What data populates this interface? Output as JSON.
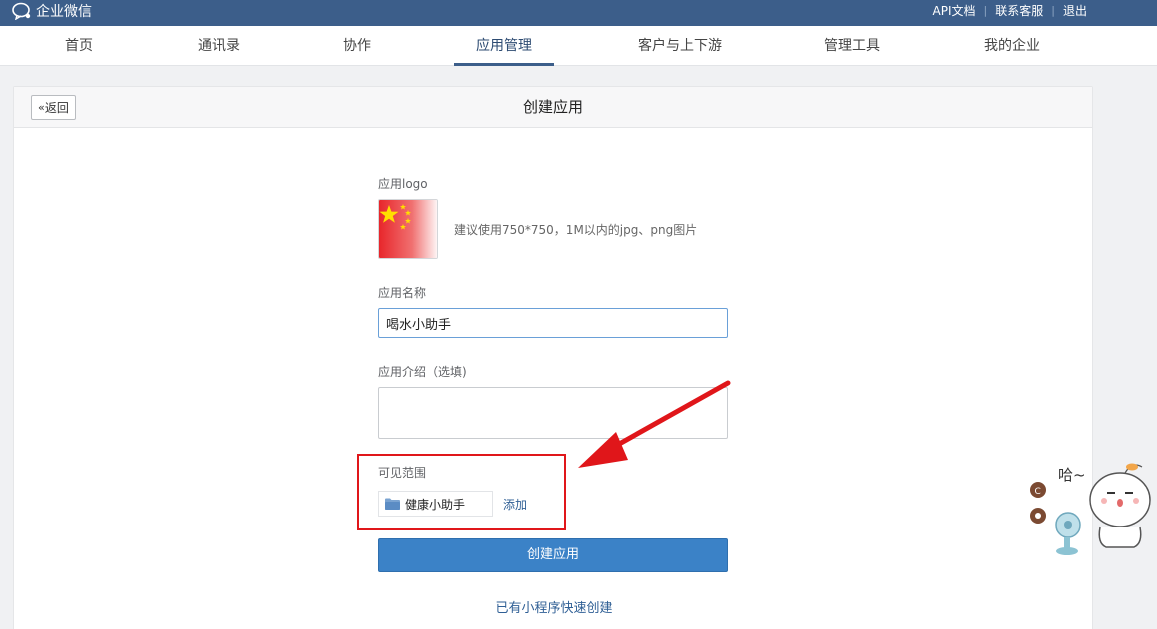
{
  "topbar": {
    "brand": "企业微信",
    "links": [
      "API文档",
      "联系客服",
      "退出"
    ]
  },
  "nav": {
    "items": [
      "首页",
      "通讯录",
      "协作",
      "应用管理",
      "客户与上下游",
      "管理工具",
      "我的企业"
    ],
    "active": "应用管理"
  },
  "page": {
    "back_label": "返回",
    "title": "创建应用"
  },
  "form": {
    "logo_label": "应用logo",
    "logo_hint": "建议使用750*750，1M以内的jpg、png图片",
    "name_label": "应用名称",
    "name_value": "喝水小助手",
    "intro_label": "应用介绍（选填)",
    "intro_value": "",
    "scope_label": "可见范围",
    "scope_item": "健康小助手",
    "add_label": "添加",
    "submit_label": "创建应用",
    "mini_program_link": "已有小程序快速创建"
  },
  "colors": {
    "topbar": "#3c5e8a",
    "primary": "#3b82c7",
    "link": "#2f5f95",
    "annotation": "#e0161a"
  }
}
